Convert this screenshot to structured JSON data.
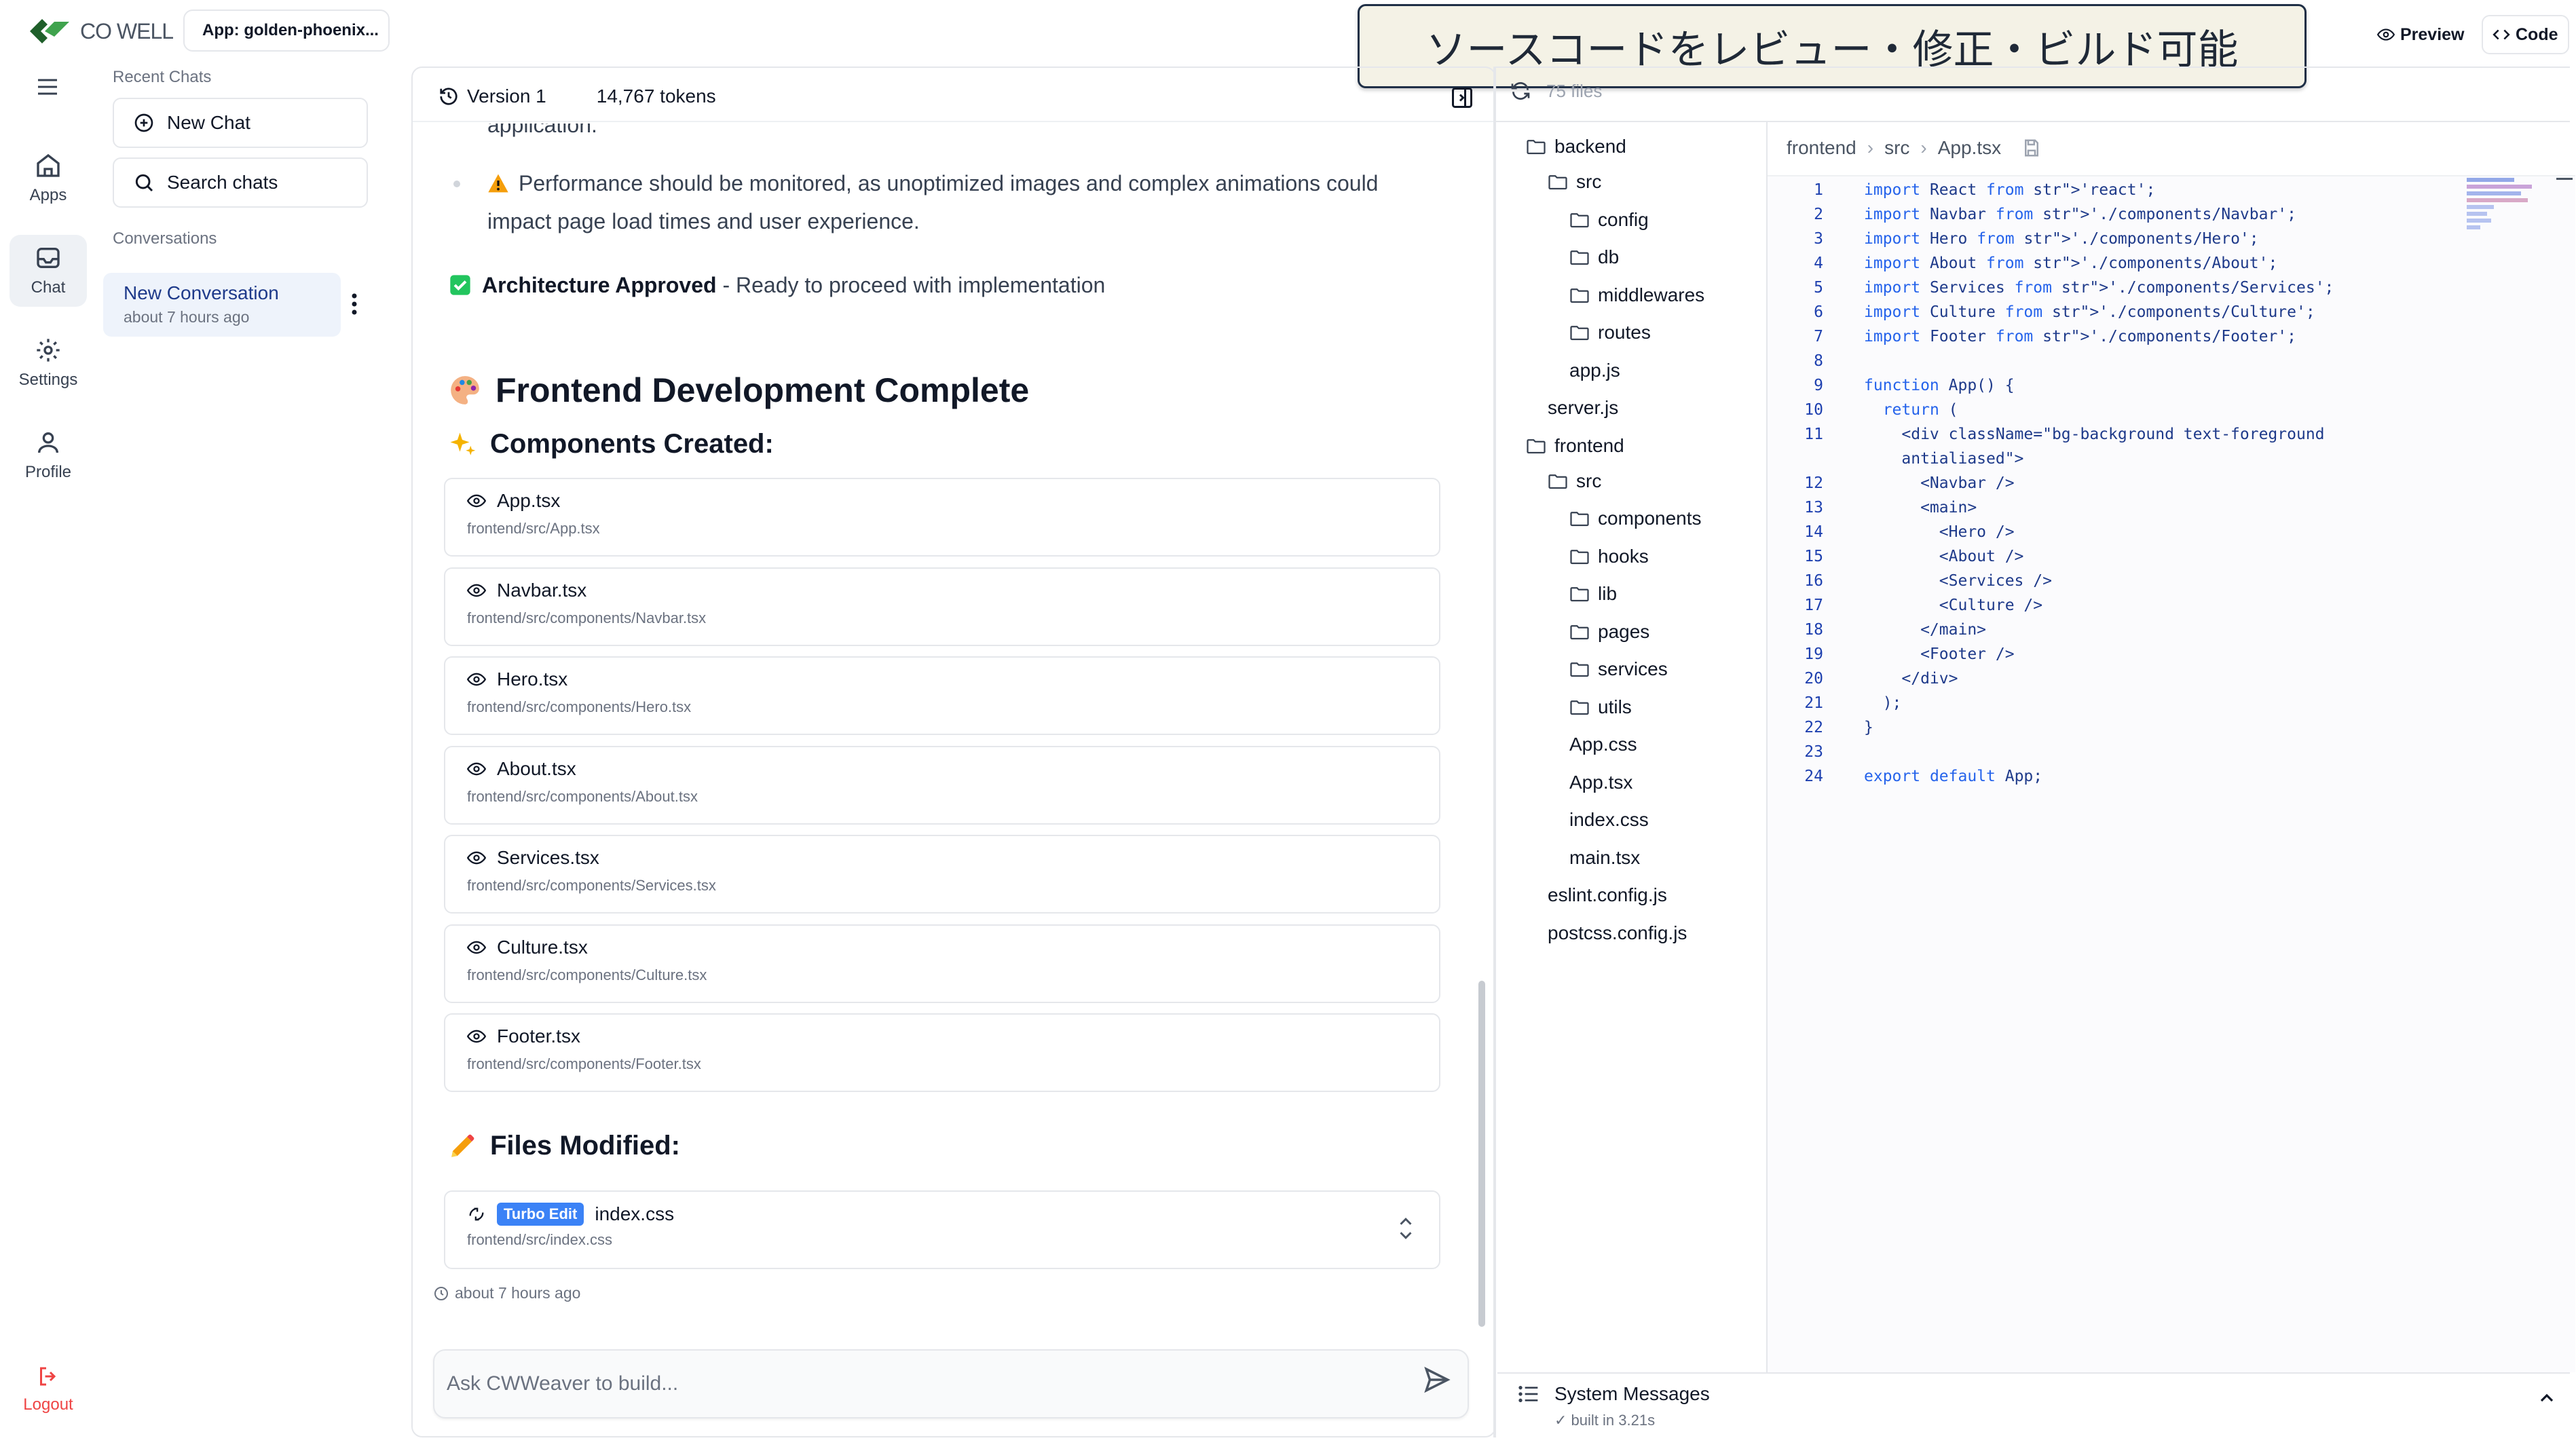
{
  "app": {
    "logo_text": "CO WELL",
    "app_chip": "App: golden-phoenix...",
    "banner_text": "ソースコードをレビュー・修正・ビルド可能",
    "preview_label": "Preview",
    "code_label": "Code"
  },
  "rail": {
    "apps": "Apps",
    "chat": "Chat",
    "settings": "Settings",
    "profile": "Profile",
    "logout": "Logout"
  },
  "sidebar": {
    "recent_chats": "Recent Chats",
    "new_chat": "New Chat",
    "search_chats": "Search chats",
    "conversations": "Conversations",
    "conversation": {
      "title": "New Conversation",
      "time": "about 7 hours ago"
    }
  },
  "chat": {
    "version": "Version 1",
    "tokens": "14,767 tokens",
    "cut_text": "application.",
    "warning_text_1": "Performance should be monitored, as unoptimized images and complex animations could",
    "warning_text_2": "impact page load times and user experience.",
    "approved_bold": "Architecture Approved",
    "approved_rest": " - Ready to proceed with implementation",
    "frontend_heading": "Frontend Development Complete",
    "components_heading": "Components Created:",
    "components": [
      {
        "name": "App.tsx",
        "path": "frontend/src/App.tsx"
      },
      {
        "name": "Navbar.tsx",
        "path": "frontend/src/components/Navbar.tsx"
      },
      {
        "name": "Hero.tsx",
        "path": "frontend/src/components/Hero.tsx"
      },
      {
        "name": "About.tsx",
        "path": "frontend/src/components/About.tsx"
      },
      {
        "name": "Services.tsx",
        "path": "frontend/src/components/Services.tsx"
      },
      {
        "name": "Culture.tsx",
        "path": "frontend/src/components/Culture.tsx"
      },
      {
        "name": "Footer.tsx",
        "path": "frontend/src/components/Footer.tsx"
      }
    ],
    "files_modified_heading": "Files Modified:",
    "modified": {
      "badge": "Turbo Edit",
      "name": "index.css",
      "path": "frontend/src/index.css"
    },
    "timestamp": "about 7 hours ago",
    "input_placeholder": "Ask CWWeaver to build..."
  },
  "files": {
    "count": "75 files",
    "tree": [
      {
        "label": "backend",
        "type": "folder",
        "depth": 0
      },
      {
        "label": "src",
        "type": "folder",
        "depth": 1
      },
      {
        "label": "config",
        "type": "folder",
        "depth": 2
      },
      {
        "label": "db",
        "type": "folder",
        "depth": 2
      },
      {
        "label": "middlewares",
        "type": "folder",
        "depth": 2
      },
      {
        "label": "routes",
        "type": "folder",
        "depth": 2
      },
      {
        "label": "app.js",
        "type": "file",
        "depth": 2
      },
      {
        "label": "server.js",
        "type": "file",
        "depth": 1
      },
      {
        "label": "frontend",
        "type": "folder",
        "depth": 0
      },
      {
        "label": "src",
        "type": "folder",
        "depth": 1
      },
      {
        "label": "components",
        "type": "folder",
        "depth": 2
      },
      {
        "label": "hooks",
        "type": "folder",
        "depth": 2
      },
      {
        "label": "lib",
        "type": "folder",
        "depth": 2
      },
      {
        "label": "pages",
        "type": "folder",
        "depth": 2
      },
      {
        "label": "services",
        "type": "folder",
        "depth": 2
      },
      {
        "label": "utils",
        "type": "folder",
        "depth": 2
      },
      {
        "label": "App.css",
        "type": "file",
        "depth": 2
      },
      {
        "label": "App.tsx",
        "type": "file",
        "depth": 2
      },
      {
        "label": "index.css",
        "type": "file",
        "depth": 2
      },
      {
        "label": "main.tsx",
        "type": "file",
        "depth": 2
      },
      {
        "label": "eslint.config.js",
        "type": "file",
        "depth": 1
      },
      {
        "label": "postcss.config.js",
        "type": "file",
        "depth": 1
      }
    ]
  },
  "editor": {
    "breadcrumb": [
      "frontend",
      "src",
      "App.tsx"
    ],
    "lines": [
      {
        "n": "1",
        "code": "import React from 'react';"
      },
      {
        "n": "2",
        "code": "import Navbar from './components/Navbar';"
      },
      {
        "n": "3",
        "code": "import Hero from './components/Hero';"
      },
      {
        "n": "4",
        "code": "import About from './components/About';"
      },
      {
        "n": "5",
        "code": "import Services from './components/Services';"
      },
      {
        "n": "6",
        "code": "import Culture from './components/Culture';"
      },
      {
        "n": "7",
        "code": "import Footer from './components/Footer';"
      },
      {
        "n": "8",
        "code": ""
      },
      {
        "n": "9",
        "code": "function App() {"
      },
      {
        "n": "10",
        "code": "  return ("
      },
      {
        "n": "11",
        "code": "    <div className=\"bg-background text-foreground"
      },
      {
        "n": "",
        "code": "    antialiased\">"
      },
      {
        "n": "12",
        "code": "      <Navbar />"
      },
      {
        "n": "13",
        "code": "      <main>"
      },
      {
        "n": "14",
        "code": "        <Hero />"
      },
      {
        "n": "15",
        "code": "        <About />"
      },
      {
        "n": "16",
        "code": "        <Services />"
      },
      {
        "n": "17",
        "code": "        <Culture />"
      },
      {
        "n": "18",
        "code": "      </main>"
      },
      {
        "n": "19",
        "code": "      <Footer />"
      },
      {
        "n": "20",
        "code": "    </div>"
      },
      {
        "n": "21",
        "code": "  );"
      },
      {
        "n": "22",
        "code": "}"
      },
      {
        "n": "23",
        "code": ""
      },
      {
        "n": "24",
        "code": "export default App;"
      }
    ]
  },
  "system": {
    "title": "System Messages",
    "status": "✓ built in 3.21s"
  },
  "colors": {
    "accent": "#3b82f6",
    "logo_green": "#2e7d32",
    "logout_red": "#ef4444",
    "approved_green": "#22c55e"
  }
}
